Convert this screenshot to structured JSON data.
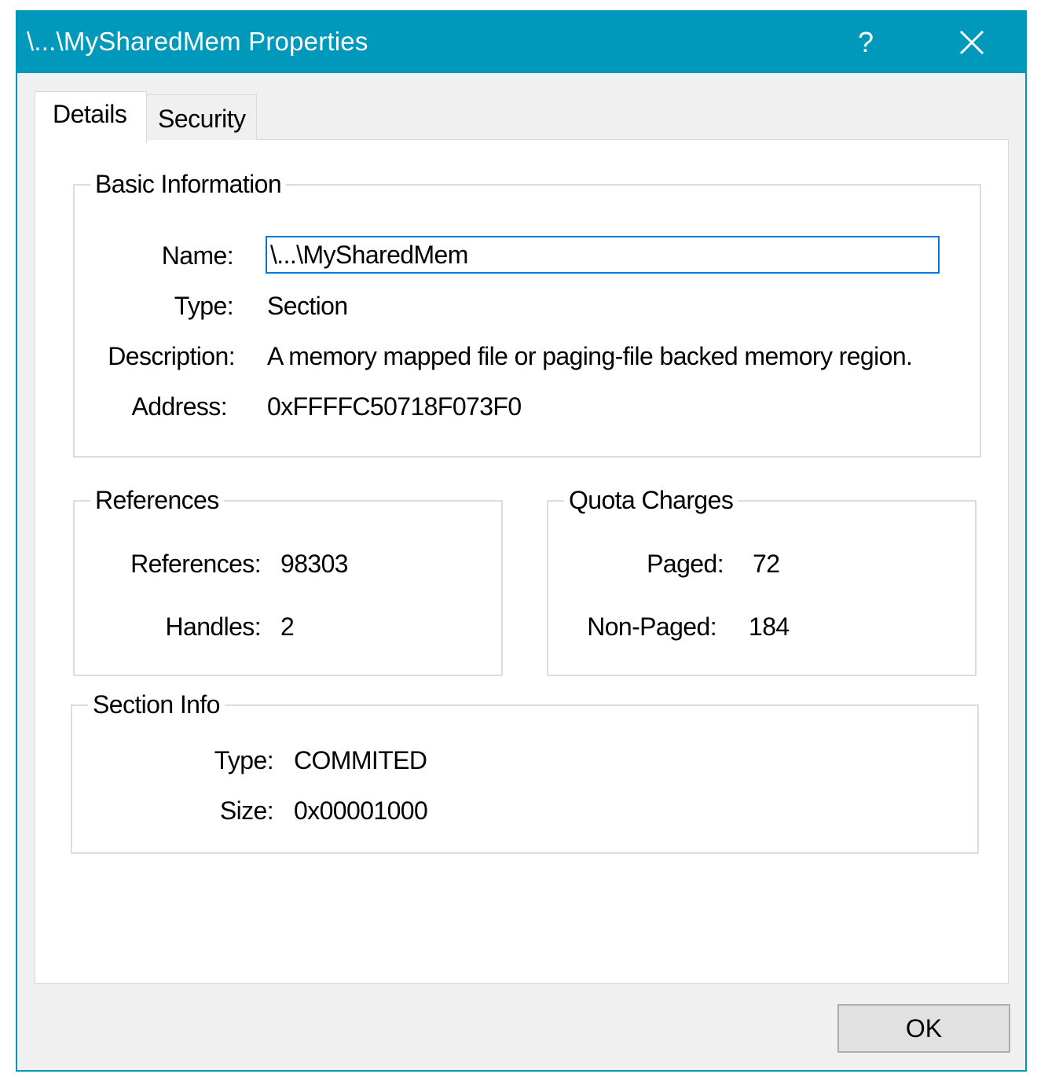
{
  "window": {
    "title": "\\...\\MySharedMem Properties",
    "help_label": "?",
    "accent_color": "#0099bc"
  },
  "tabs": [
    {
      "label": "Details",
      "selected": true
    },
    {
      "label": "Security",
      "selected": false
    }
  ],
  "basic_info": {
    "title": "Basic Information",
    "name_label": "Name:",
    "name_value": "\\...\\MySharedMem",
    "type_label": "Type:",
    "type_value": "Section",
    "description_label": "Description:",
    "description_value": "A memory mapped file or paging-file backed memory region.",
    "address_label": "Address:",
    "address_value": "0xFFFFC50718F073F0"
  },
  "references": {
    "title": "References",
    "references_label": "References:",
    "references_value": "98303",
    "handles_label": "Handles:",
    "handles_value": "2"
  },
  "quota_charges": {
    "title": "Quota Charges",
    "paged_label": "Paged:",
    "paged_value": "72",
    "nonpaged_label": "Non-Paged:",
    "nonpaged_value": "184"
  },
  "section_info": {
    "title": "Section Info",
    "type_label": "Type:",
    "type_value": "COMMITED",
    "size_label": "Size:",
    "size_value": "0x00001000"
  },
  "buttons": {
    "ok_label": "OK"
  },
  "icons": {
    "close": "close-icon"
  }
}
